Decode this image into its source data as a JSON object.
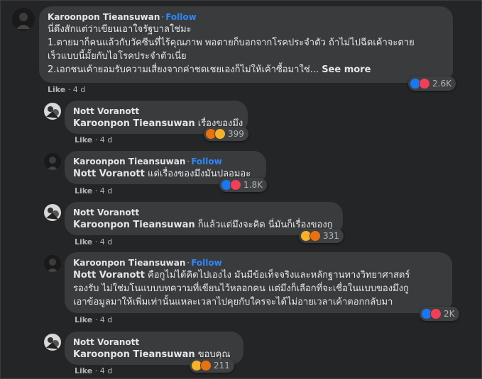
{
  "comments": [
    {
      "author": "Karoonpon Tieansuwan",
      "follow": "Follow",
      "lines": [
        "นี่ดึงสักแต่ว่าเขียนเอาใจรัฐบาลใช่มะ",
        "1.ตายมาก็คนแล้วกับวัคซีนที่ไร้คุณภาพ พอตายก็บอกจากโรคประจำตัว ถ้าไม่ไปฉีดเค้าจะตาย",
        "เร็วแบบนี้มั้ยกับไอโรคประจำตัวเนี่ย",
        "2.เอกชนเค้ายอมรับความเสี่ยงจากค่าชดเชยเองก็ไม่ให้เค้าซื้อมาใช่..."
      ],
      "see_more": "See more",
      "like": "Like",
      "time": "4 d",
      "reactions": [
        "like-icon",
        "heart-icon"
      ],
      "count": "2.6K"
    },
    {
      "author": "Nott Voranott",
      "tag": "Karoonpon Tieansuwan",
      "text": "เรื่องของมึง",
      "like": "Like",
      "time": "4 d",
      "reactions": [
        "angry-icon",
        "haha-icon"
      ],
      "count": "399"
    },
    {
      "author": "Karoonpon Tieansuwan",
      "follow": "Follow",
      "tag": "Nott Voranott",
      "text": "แต่เรื่องของมึงมันปลอมอะ",
      "like": "Like",
      "time": "4 d",
      "reactions": [
        "like-icon",
        "heart-icon"
      ],
      "count": "1.8K"
    },
    {
      "author": "Nott Voranott",
      "tag": "Karoonpon Tieansuwan",
      "text": "ก็แล้วแต่มึงจะคิด นี่มันก็เรื่องของกู",
      "like": "Like",
      "time": "4 d",
      "reactions": [
        "haha-icon",
        "angry-icon"
      ],
      "count": "331"
    },
    {
      "author": "Karoonpon Tieansuwan",
      "follow": "Follow",
      "tag": "Nott Voranott",
      "lines": [
        "คือกูไม่ได้คิดไปเองไง มันมีข้อเท็จจริงและหลักฐานทางวิทยาศาสตร์",
        "รองรับ ไม่ใช่มโนแบบบทความที่เขียนไว้หลอกคน แต่มึงก็เลือกที่จะเชื่อในแบบของมึงกู",
        "เอาข้อมูลมาให้เพิ่มเท่านั้นแหละเวลาไปคุยกับใครจะได้ไม่อายเวลาเค้าตอกกลับมา"
      ],
      "like": "Like",
      "time": "4 d",
      "reactions": [
        "like-icon",
        "heart-icon"
      ],
      "count": "2K"
    },
    {
      "author": "Nott Voranott",
      "tag": "Karoonpon Tieansuwan",
      "text": "ขอบคุณ",
      "like": "Like",
      "time": "4 d",
      "reactions": [
        "haha-icon",
        "angry-icon"
      ],
      "count": "211"
    }
  ],
  "colors": {
    "background": "#242526",
    "bubble": "#3a3b3c",
    "follow": "#2d88ff",
    "secondary_text": "#b0b3b8"
  }
}
